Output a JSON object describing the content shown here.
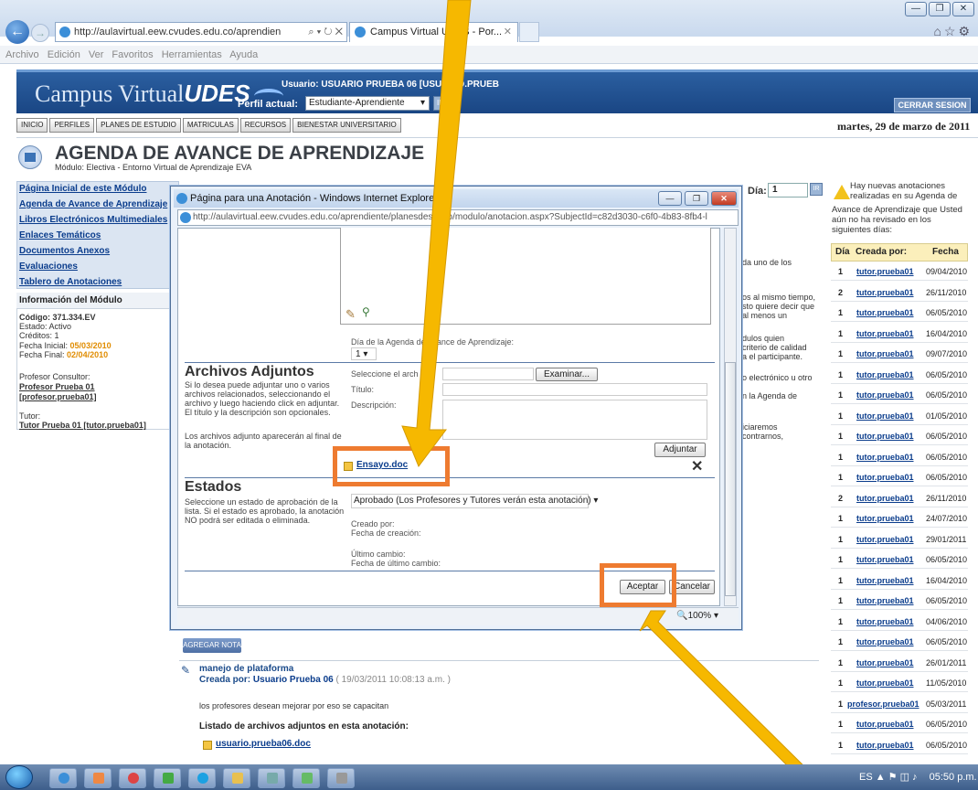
{
  "browser": {
    "url": "http://aulavirtual.eew.cvudes.edu.co/aprendien",
    "tab_title": "Campus Virtual UDES - Por...",
    "menu": "Archivo  Edición  Ver  Favoritos  Herramientas  Ayuda"
  },
  "header": {
    "logo_text": "Campus Virtual",
    "logo_bold": "UDES",
    "usuario": "Usuario: USUARIO PRUEBA 06 [USUARIO.PRUEB",
    "perfil_label": "Perfil actual:",
    "perfil_value": "Estudiante-Aprendiente",
    "ir_label": "IR",
    "cerrar_label": "CERRAR SESION"
  },
  "nav": [
    "INICIO",
    "PERFILES",
    "PLANES DE ESTUDIO",
    "MATRICULAS",
    "RECURSOS",
    "BIENESTAR UNIVERSITARIO"
  ],
  "date": "martes, 29 de marzo de 2011",
  "page": {
    "title": "AGENDA DE AVANCE DE APRENDIZAJE",
    "modulo": "Módulo: Electiva - Entorno Virtual de Aprendizaje EVA"
  },
  "sidebar": {
    "links": [
      "Página Inicial de este Módulo",
      "Agenda de Avance de Aprendizaje",
      "Libros Electrónicos Multimediales",
      "Enlaces Temáticos",
      "Documentos Anexos",
      "Evaluaciones",
      "Tablero de Anotaciones"
    ],
    "info_title": "Información del Módulo",
    "codigo": "Código: 371.334.EV",
    "estado": "Estado: Activo",
    "creditos": "Créditos: 1",
    "fecha_inicial_lbl": "Fecha Inicial:",
    "fecha_inicial": "05/03/2010",
    "fecha_final_lbl": "Fecha Final:",
    "fecha_final": "02/04/2010",
    "profesor_lbl": "Profesor Consultor:",
    "profesor": "Profesor Prueba 01",
    "profesor_user": "[profesor.prueba01]",
    "tutor_lbl": "Tutor:",
    "tutor": "Tutor Prueba 01 [tutor.prueba01]"
  },
  "right": {
    "dia_label": "Día:",
    "dia_value": "1",
    "ir_label": "IR",
    "notice_line1": "Hay nuevas anotaciones realizadas en su Agenda de",
    "notice_line2": "Avance de Aprendizaje que Usted aún no ha revisado en los siguientes días:",
    "headers": [
      "Día",
      "Creada por:",
      "Fecha"
    ],
    "rows": [
      [
        "1",
        "tutor.prueba01",
        "09/04/2010"
      ],
      [
        "2",
        "tutor.prueba01",
        "26/11/2010"
      ],
      [
        "1",
        "tutor.prueba01",
        "06/05/2010"
      ],
      [
        "1",
        "tutor.prueba01",
        "16/04/2010"
      ],
      [
        "1",
        "tutor.prueba01",
        "09/07/2010"
      ],
      [
        "1",
        "tutor.prueba01",
        "06/05/2010"
      ],
      [
        "1",
        "tutor.prueba01",
        "06/05/2010"
      ],
      [
        "1",
        "tutor.prueba01",
        "01/05/2010"
      ],
      [
        "1",
        "tutor.prueba01",
        "06/05/2010"
      ],
      [
        "1",
        "tutor.prueba01",
        "06/05/2010"
      ],
      [
        "1",
        "tutor.prueba01",
        "06/05/2010"
      ],
      [
        "2",
        "tutor.prueba01",
        "26/11/2010"
      ],
      [
        "1",
        "tutor.prueba01",
        "24/07/2010"
      ],
      [
        "1",
        "tutor.prueba01",
        "29/01/2011"
      ],
      [
        "1",
        "tutor.prueba01",
        "06/05/2010"
      ],
      [
        "1",
        "tutor.prueba01",
        "16/04/2010"
      ],
      [
        "1",
        "tutor.prueba01",
        "06/05/2010"
      ],
      [
        "1",
        "tutor.prueba01",
        "04/06/2010"
      ],
      [
        "1",
        "tutor.prueba01",
        "06/05/2010"
      ],
      [
        "1",
        "tutor.prueba01",
        "26/01/2011"
      ],
      [
        "1",
        "tutor.prueba01",
        "11/05/2010"
      ],
      [
        "1",
        "profesor.prueba01",
        "05/03/2011"
      ],
      [
        "1",
        "tutor.prueba01",
        "06/05/2010"
      ],
      [
        "1",
        "tutor.prueba01",
        "06/05/2010"
      ]
    ],
    "bg_text": [
      "da uno de los",
      "os al mismo tiempo,",
      "sto quiere decir que",
      "al menos un",
      "dulos quien",
      "criterio de calidad",
      "a el participante.",
      "o electrónico u otro",
      "n la Agenda de",
      "iciaremos",
      "contrarnos,"
    ]
  },
  "popup": {
    "title": "Página para una Anotación - Windows Internet Explorer",
    "url": "http://aulavirtual.eew.cvudes.edu.co/aprendiente/planesdestudio/modulo/anotacion.aspx?SubjectId=c82d3030-c6f0-4b83-8fb4-l",
    "dia_agenda_label": "Día de la Agenda de Avance de Aprendizaje:",
    "dia_agenda_value": "1",
    "archivos_title": "Archivos Adjuntos",
    "archivos_desc": "Si lo desea puede adjuntar uno o varios archivos relacionados, seleccionando el archivo y luego haciendo click en adjuntar. El título y la descripción son opcionales.",
    "archivos_desc2": "Los archivos adjunto aparecerán al final de la anotación.",
    "seleccione_label": "Seleccione el arch",
    "examinar_label": "Examinar...",
    "titulo_label": "Título:",
    "descripcion_label": "Descripción:",
    "adjuntar_label": "Adjuntar",
    "attached_file": "Ensayo.doc",
    "estados_title": "Estados",
    "estados_desc": "Seleccione un estado de aprobación de la lista. Si el estado es aprobado, la anotación NO podrá ser editada o eliminada.",
    "estado_value": "Aprobado (Los Profesores y Tutores verán esta anotación)",
    "creado_por": "Creado por:",
    "fecha_creacion": "Fecha de creación:",
    "ultimo_cambio": "Último cambio:",
    "fecha_ultimo": "Fecha de último cambio:",
    "aceptar_label": "Aceptar",
    "cancelar_label": "Cancelar",
    "zoom": "100%"
  },
  "below": {
    "agregar_label": "AGREGAR NOTA",
    "nota_title": "manejo de plataforma",
    "nota_by_label": "Creada por:",
    "nota_by_name": "Usuario Prueba 06",
    "nota_timestamp": "( 19/03/2011 10:08:13 a.m. )",
    "nota_text": "los profesores desean mejorar por eso se capacitan",
    "listado_label": "Listado de archivos adjuntos en esta anotación:",
    "adjunto_file": "usuario.prueba06.doc"
  },
  "taskbar": {
    "lang": "ES",
    "time": "05:50 p.m."
  },
  "colors": {
    "highlight": "#ee7b30",
    "arrow": "#f6b800",
    "header_bg": "#1f4f8e"
  }
}
